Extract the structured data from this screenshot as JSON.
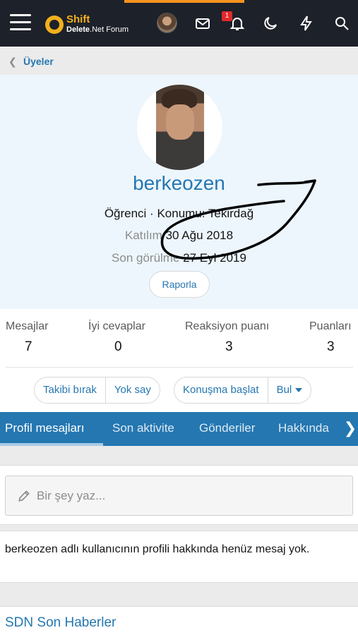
{
  "header": {
    "logo": {
      "line1": "Shift",
      "line2_bold": "Delete",
      "line2_rest": ".Net Forum"
    },
    "notification_count": "1",
    "icons": [
      "menu-icon",
      "avatar",
      "mail-icon",
      "bell-icon",
      "moon-icon",
      "bolt-icon",
      "search-icon"
    ]
  },
  "breadcrumb": {
    "label": "Üyeler"
  },
  "profile": {
    "username": "berkeozen",
    "bio": "Öğrenci · Konumu: Tekirdağ",
    "joined_label": "Katılım",
    "joined_value": "30 Ağu 2018",
    "lastseen_label": "Son görülme",
    "lastseen_value": "27 Eyl 2019",
    "report": "Raporla"
  },
  "stats": [
    {
      "label": "Mesajlar",
      "value": "7"
    },
    {
      "label": "İyi cevaplar",
      "value": "0"
    },
    {
      "label": "Reaksiyon puanı",
      "value": "3"
    },
    {
      "label": "Puanları",
      "value": "3"
    }
  ],
  "actions": {
    "unfollow": "Takibi bırak",
    "ignore": "Yok say",
    "start_conversation": "Konuşma başlat",
    "find": "Bul"
  },
  "tabs": [
    "Profil mesajları",
    "Son aktivite",
    "Gönderiler",
    "Hakkında"
  ],
  "active_tab": "Profil mesajları",
  "composer": {
    "placeholder": "Bir şey yaz..."
  },
  "empty_message": "berkeozen adlı kullanıcının profili hakkında henüz mesaj yok.",
  "news_heading": "SDN Son Haberler",
  "colors": {
    "nav_bg": "#1d2129",
    "accent": "#f7931e",
    "link": "#2577b1",
    "profile_bg": "#edf6fd",
    "badge": "#e0292b"
  }
}
